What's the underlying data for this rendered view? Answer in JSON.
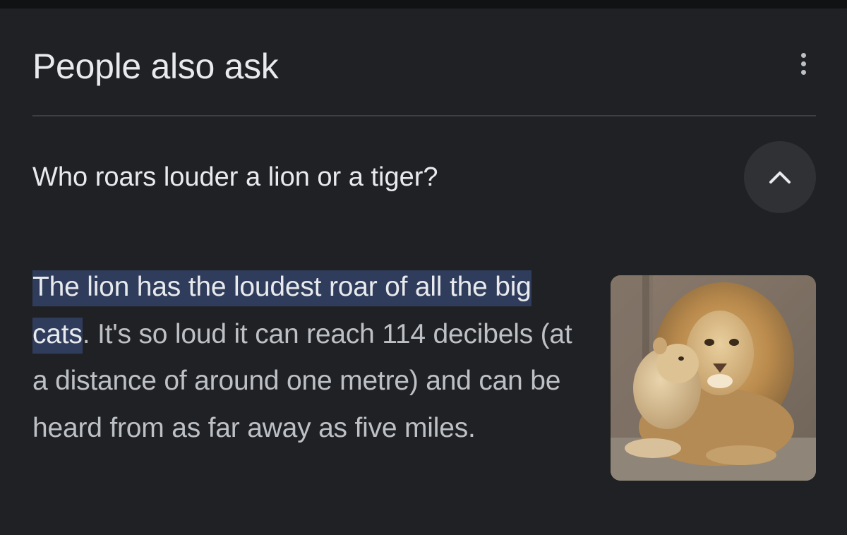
{
  "header": {
    "title": "People also ask",
    "more_icon": "vertical-dots-icon"
  },
  "question": {
    "text": "Who roars louder a lion or a tiger?",
    "toggle_icon": "chevron-up-icon"
  },
  "answer": {
    "highlighted_text": "The lion has the loudest roar of all the big cats",
    "rest_text": ". It's so loud it can reach 114 decibels (at a distance of around one metre) and can be heard from as far away as five miles.",
    "highlight_color": "#2f3c5b"
  },
  "image": {
    "alt": "lion and cub"
  },
  "colors": {
    "background": "#202124",
    "title_text": "#e8eaed",
    "body_text": "#bdc1c6",
    "divider": "#3c4043",
    "button_bg": "#303134"
  }
}
